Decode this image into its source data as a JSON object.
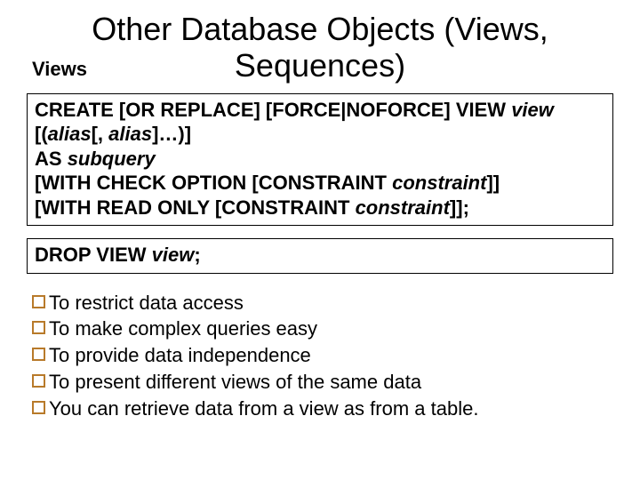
{
  "title_line1": "Other Database Objects (Views,",
  "title_line2": "Sequences)",
  "subheading": "Views",
  "create_box": {
    "l1_a": "CREATE [OR REPLACE] [FORCE|NOFORCE] VIEW ",
    "l1_b": "view",
    "l2_a": "[(",
    "l2_b": "alias",
    "l2_c": "[, ",
    "l2_d": "alias",
    "l2_e": "]…)]",
    "l3_a": "AS ",
    "l3_b": "subquery",
    "l4_a": "[WITH CHECK OPTION [CONSTRAINT ",
    "l4_b": "constraint",
    "l4_c": "]]",
    "l5_a": "[WITH READ ONLY [CONSTRAINT ",
    "l5_b": "constraint",
    "l5_c": "]];"
  },
  "drop_box": {
    "a": "DROP VIEW ",
    "b": "view",
    "c": ";"
  },
  "bullets": [
    "To restrict data access",
    "To make complex queries easy",
    "To provide data independence",
    "To present different views of the same data",
    "You can retrieve data from a view as from a table."
  ]
}
